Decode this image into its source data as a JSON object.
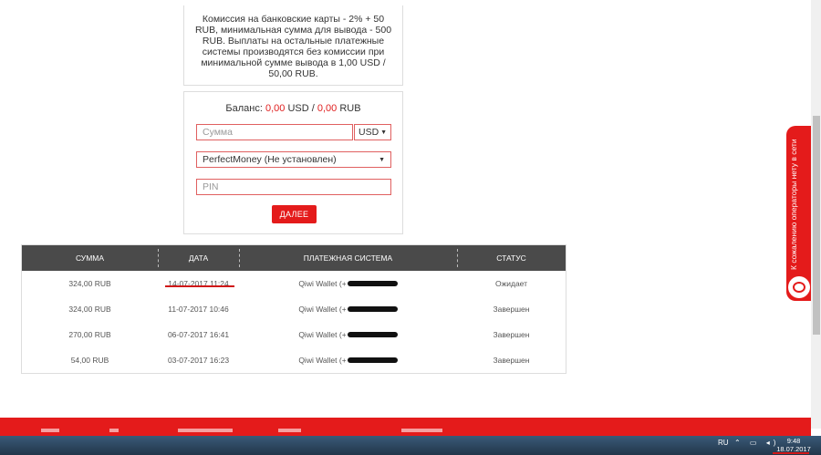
{
  "info": {
    "text": "Комиссия на банковские карты - 2% + 50 RUB, минимальная сумма для вывода - 500 RUB. Выплаты на остальные платежные системы производятся без комиссии при минимальной сумме вывода в 1,00 USD / 50,00 RUB."
  },
  "balance": {
    "label": "Баланс:",
    "usd_value": "0,00",
    "usd_unit": "USD",
    "sep": "/",
    "rub_value": "0,00",
    "rub_unit": "RUB"
  },
  "form": {
    "amount_placeholder": "Сумма",
    "currency": "USD",
    "payment_system": "PerfectMoney (Не установлен)",
    "pin_placeholder": "PIN",
    "submit_label": "ДАЛЕЕ"
  },
  "table": {
    "headers": [
      "СУММА",
      "ДАТА",
      "ПЛАТЕЖНАЯ СИСТЕМА",
      "СТАТУС"
    ],
    "rows": [
      {
        "amount": "324,00 RUB",
        "date": "14-07-2017 11:24",
        "system": "Qiwi Wallet (+",
        "status": "Ожидает"
      },
      {
        "amount": "324,00 RUB",
        "date": "11-07-2017 10:46",
        "system": "Qiwi Wallet (+",
        "status": "Завершен"
      },
      {
        "amount": "270,00 RUB",
        "date": "06-07-2017 16:41",
        "system": "Qiwi Wallet (+",
        "status": "Завершен"
      },
      {
        "amount": "54,00 RUB",
        "date": "03-07-2017 16:23",
        "system": "Qiwi Wallet (+",
        "status": "Завершен"
      }
    ]
  },
  "chat": {
    "label": "К сожалению операторы нету в сети",
    "icon": "chat-bubble-icon"
  },
  "taskbar": {
    "lang": "RU",
    "time": "9:48",
    "date": "18.07.2017"
  },
  "colors": {
    "accent": "#e41b1b",
    "table_header": "#4a4a4a"
  }
}
